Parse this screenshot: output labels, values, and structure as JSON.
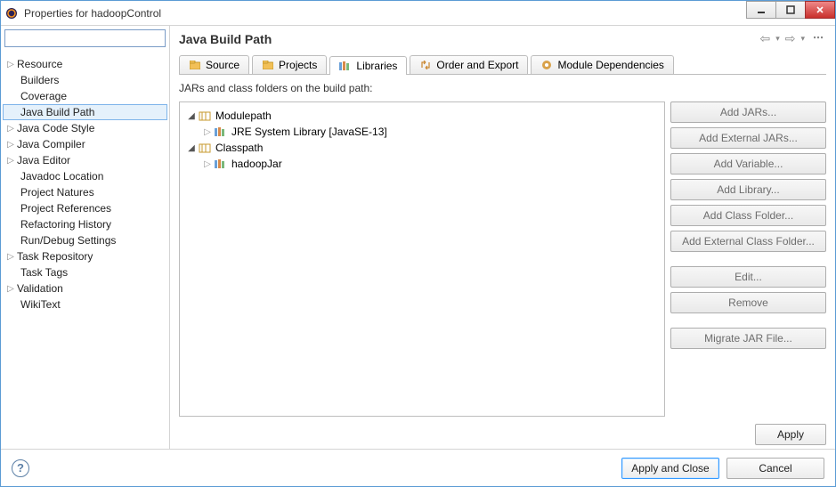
{
  "window": {
    "title": "Properties for hadoopControl"
  },
  "sidebar": {
    "items": [
      {
        "label": "Resource",
        "expandable": true
      },
      {
        "label": "Builders",
        "expandable": false
      },
      {
        "label": "Coverage",
        "expandable": false
      },
      {
        "label": "Java Build Path",
        "expandable": false,
        "selected": true
      },
      {
        "label": "Java Code Style",
        "expandable": true
      },
      {
        "label": "Java Compiler",
        "expandable": true
      },
      {
        "label": "Java Editor",
        "expandable": true
      },
      {
        "label": "Javadoc Location",
        "expandable": false
      },
      {
        "label": "Project Natures",
        "expandable": false
      },
      {
        "label": "Project References",
        "expandable": false
      },
      {
        "label": "Refactoring History",
        "expandable": false
      },
      {
        "label": "Run/Debug Settings",
        "expandable": false
      },
      {
        "label": "Task Repository",
        "expandable": true
      },
      {
        "label": "Task Tags",
        "expandable": false
      },
      {
        "label": "Validation",
        "expandable": true
      },
      {
        "label": "WikiText",
        "expandable": false
      }
    ],
    "filter_placeholder": ""
  },
  "page": {
    "title": "Java Build Path",
    "tabs": [
      "Source",
      "Projects",
      "Libraries",
      "Order and Export",
      "Module Dependencies"
    ],
    "active_tab": 2,
    "subtitle": "JARs and class folders on the build path:",
    "tree": {
      "modulepath_label": "Modulepath",
      "jre_label": "JRE System Library [JavaSE-13]",
      "classpath_label": "Classpath",
      "hadoop_label": "hadoopJar"
    },
    "buttons": {
      "add_jars": "Add JARs...",
      "add_ext_jars": "Add External JARs...",
      "add_var": "Add Variable...",
      "add_lib": "Add Library...",
      "add_cf": "Add Class Folder...",
      "add_ext_cf": "Add External Class Folder...",
      "edit": "Edit...",
      "remove": "Remove",
      "migrate": "Migrate JAR File...",
      "apply": "Apply"
    }
  },
  "footer": {
    "apply_close": "Apply and Close",
    "cancel": "Cancel"
  }
}
